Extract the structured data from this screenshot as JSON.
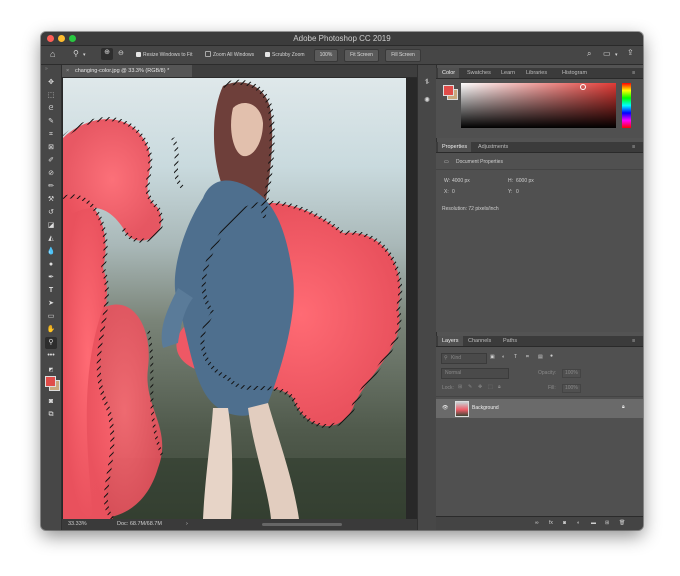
{
  "window": {
    "title": "Adobe Photoshop CC 2019"
  },
  "colors": {
    "accent_fg": "#e04c49",
    "accent_bg": "#c9a77c",
    "smoke": "#f05a66"
  },
  "options_bar": {
    "resize_windows": "Resize Windows to Fit",
    "zoom_all_windows": "Zoom All Windows",
    "scrubby_zoom": "Scrubby Zoom",
    "zoom_value": "100%",
    "fit_screen": "Fit Screen",
    "fill_screen": "Fill Screen"
  },
  "document": {
    "tab_label": "changing-color.jpg @ 33.3% (RGB/8) *",
    "close_glyph": "×"
  },
  "status_bar": {
    "zoom": "33.33%",
    "doc_size": "Doc: 68.7M/68.7M",
    "arrow": "›"
  },
  "color_panel": {
    "tabs": [
      "Color",
      "Swatches",
      "Learn",
      "Libraries",
      "Histogram"
    ]
  },
  "properties_panel": {
    "tabs": [
      "Properties",
      "Adjustments"
    ],
    "header": "Document Properties",
    "w_label": "W:",
    "w_value": "4000 px",
    "h_label": "H:",
    "h_value": "6000 px",
    "x_label": "X:",
    "x_value": "0",
    "y_label": "Y:",
    "y_value": "0",
    "resolution": "Resolution: 72 pixels/inch"
  },
  "layers_panel": {
    "tabs": [
      "Layers",
      "Channels",
      "Paths"
    ],
    "kind": "Kind",
    "blend_mode": "Normal",
    "opacity_label": "Opacity:",
    "opacity_value": "100%",
    "lock_label": "Lock:",
    "fill_label": "Fill:",
    "fill_value": "100%",
    "layers": [
      {
        "name": "Background",
        "visible": true,
        "locked": true
      }
    ]
  }
}
